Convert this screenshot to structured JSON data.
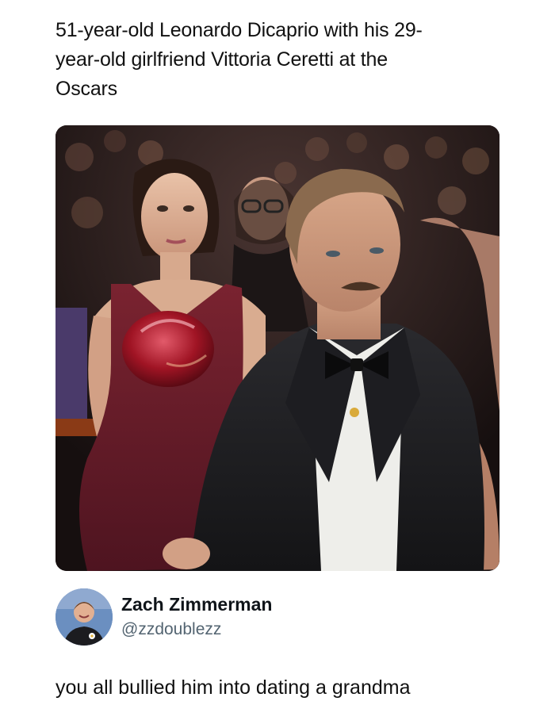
{
  "post": {
    "caption": "51-year-old Leonardo Dicaprio with his 29-\nyear-old girlfriend Vittoria Ceretti at the\nOscars"
  },
  "reply": {
    "display_name": "Zach Zimmerman",
    "handle": "@zzdoublezz",
    "text": "you all bullied him into dating a grandma"
  }
}
